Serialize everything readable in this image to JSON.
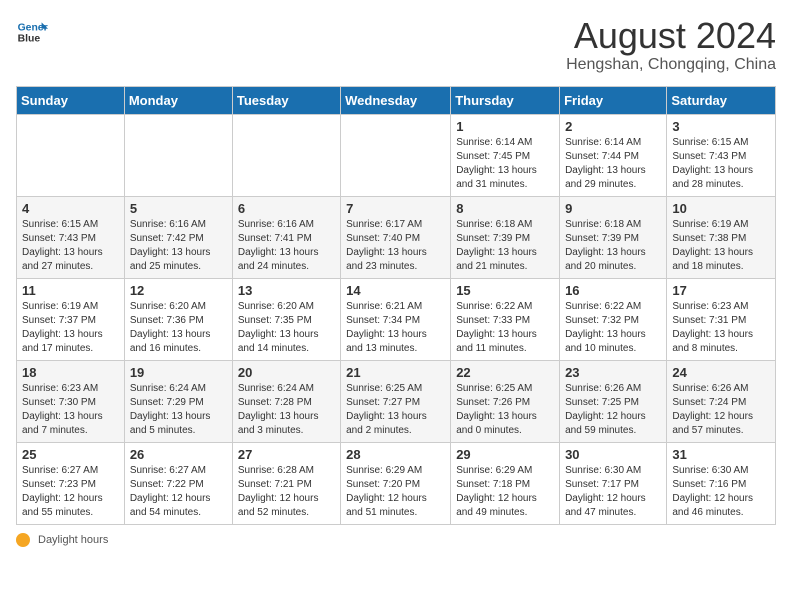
{
  "header": {
    "logo_line1": "General",
    "logo_line2": "Blue",
    "main_title": "August 2024",
    "subtitle": "Hengshan, Chongqing, China"
  },
  "days_of_week": [
    "Sunday",
    "Monday",
    "Tuesday",
    "Wednesday",
    "Thursday",
    "Friday",
    "Saturday"
  ],
  "weeks": [
    [
      {
        "day": "",
        "info": ""
      },
      {
        "day": "",
        "info": ""
      },
      {
        "day": "",
        "info": ""
      },
      {
        "day": "",
        "info": ""
      },
      {
        "day": "1",
        "info": "Sunrise: 6:14 AM\nSunset: 7:45 PM\nDaylight: 13 hours and 31 minutes."
      },
      {
        "day": "2",
        "info": "Sunrise: 6:14 AM\nSunset: 7:44 PM\nDaylight: 13 hours and 29 minutes."
      },
      {
        "day": "3",
        "info": "Sunrise: 6:15 AM\nSunset: 7:43 PM\nDaylight: 13 hours and 28 minutes."
      }
    ],
    [
      {
        "day": "4",
        "info": "Sunrise: 6:15 AM\nSunset: 7:43 PM\nDaylight: 13 hours and 27 minutes."
      },
      {
        "day": "5",
        "info": "Sunrise: 6:16 AM\nSunset: 7:42 PM\nDaylight: 13 hours and 25 minutes."
      },
      {
        "day": "6",
        "info": "Sunrise: 6:16 AM\nSunset: 7:41 PM\nDaylight: 13 hours and 24 minutes."
      },
      {
        "day": "7",
        "info": "Sunrise: 6:17 AM\nSunset: 7:40 PM\nDaylight: 13 hours and 23 minutes."
      },
      {
        "day": "8",
        "info": "Sunrise: 6:18 AM\nSunset: 7:39 PM\nDaylight: 13 hours and 21 minutes."
      },
      {
        "day": "9",
        "info": "Sunrise: 6:18 AM\nSunset: 7:39 PM\nDaylight: 13 hours and 20 minutes."
      },
      {
        "day": "10",
        "info": "Sunrise: 6:19 AM\nSunset: 7:38 PM\nDaylight: 13 hours and 18 minutes."
      }
    ],
    [
      {
        "day": "11",
        "info": "Sunrise: 6:19 AM\nSunset: 7:37 PM\nDaylight: 13 hours and 17 minutes."
      },
      {
        "day": "12",
        "info": "Sunrise: 6:20 AM\nSunset: 7:36 PM\nDaylight: 13 hours and 16 minutes."
      },
      {
        "day": "13",
        "info": "Sunrise: 6:20 AM\nSunset: 7:35 PM\nDaylight: 13 hours and 14 minutes."
      },
      {
        "day": "14",
        "info": "Sunrise: 6:21 AM\nSunset: 7:34 PM\nDaylight: 13 hours and 13 minutes."
      },
      {
        "day": "15",
        "info": "Sunrise: 6:22 AM\nSunset: 7:33 PM\nDaylight: 13 hours and 11 minutes."
      },
      {
        "day": "16",
        "info": "Sunrise: 6:22 AM\nSunset: 7:32 PM\nDaylight: 13 hours and 10 minutes."
      },
      {
        "day": "17",
        "info": "Sunrise: 6:23 AM\nSunset: 7:31 PM\nDaylight: 13 hours and 8 minutes."
      }
    ],
    [
      {
        "day": "18",
        "info": "Sunrise: 6:23 AM\nSunset: 7:30 PM\nDaylight: 13 hours and 7 minutes."
      },
      {
        "day": "19",
        "info": "Sunrise: 6:24 AM\nSunset: 7:29 PM\nDaylight: 13 hours and 5 minutes."
      },
      {
        "day": "20",
        "info": "Sunrise: 6:24 AM\nSunset: 7:28 PM\nDaylight: 13 hours and 3 minutes."
      },
      {
        "day": "21",
        "info": "Sunrise: 6:25 AM\nSunset: 7:27 PM\nDaylight: 13 hours and 2 minutes."
      },
      {
        "day": "22",
        "info": "Sunrise: 6:25 AM\nSunset: 7:26 PM\nDaylight: 13 hours and 0 minutes."
      },
      {
        "day": "23",
        "info": "Sunrise: 6:26 AM\nSunset: 7:25 PM\nDaylight: 12 hours and 59 minutes."
      },
      {
        "day": "24",
        "info": "Sunrise: 6:26 AM\nSunset: 7:24 PM\nDaylight: 12 hours and 57 minutes."
      }
    ],
    [
      {
        "day": "25",
        "info": "Sunrise: 6:27 AM\nSunset: 7:23 PM\nDaylight: 12 hours and 55 minutes."
      },
      {
        "day": "26",
        "info": "Sunrise: 6:27 AM\nSunset: 7:22 PM\nDaylight: 12 hours and 54 minutes."
      },
      {
        "day": "27",
        "info": "Sunrise: 6:28 AM\nSunset: 7:21 PM\nDaylight: 12 hours and 52 minutes."
      },
      {
        "day": "28",
        "info": "Sunrise: 6:29 AM\nSunset: 7:20 PM\nDaylight: 12 hours and 51 minutes."
      },
      {
        "day": "29",
        "info": "Sunrise: 6:29 AM\nSunset: 7:18 PM\nDaylight: 12 hours and 49 minutes."
      },
      {
        "day": "30",
        "info": "Sunrise: 6:30 AM\nSunset: 7:17 PM\nDaylight: 12 hours and 47 minutes."
      },
      {
        "day": "31",
        "info": "Sunrise: 6:30 AM\nSunset: 7:16 PM\nDaylight: 12 hours and 46 minutes."
      }
    ]
  ],
  "footer": {
    "note_label": "Daylight hours"
  }
}
